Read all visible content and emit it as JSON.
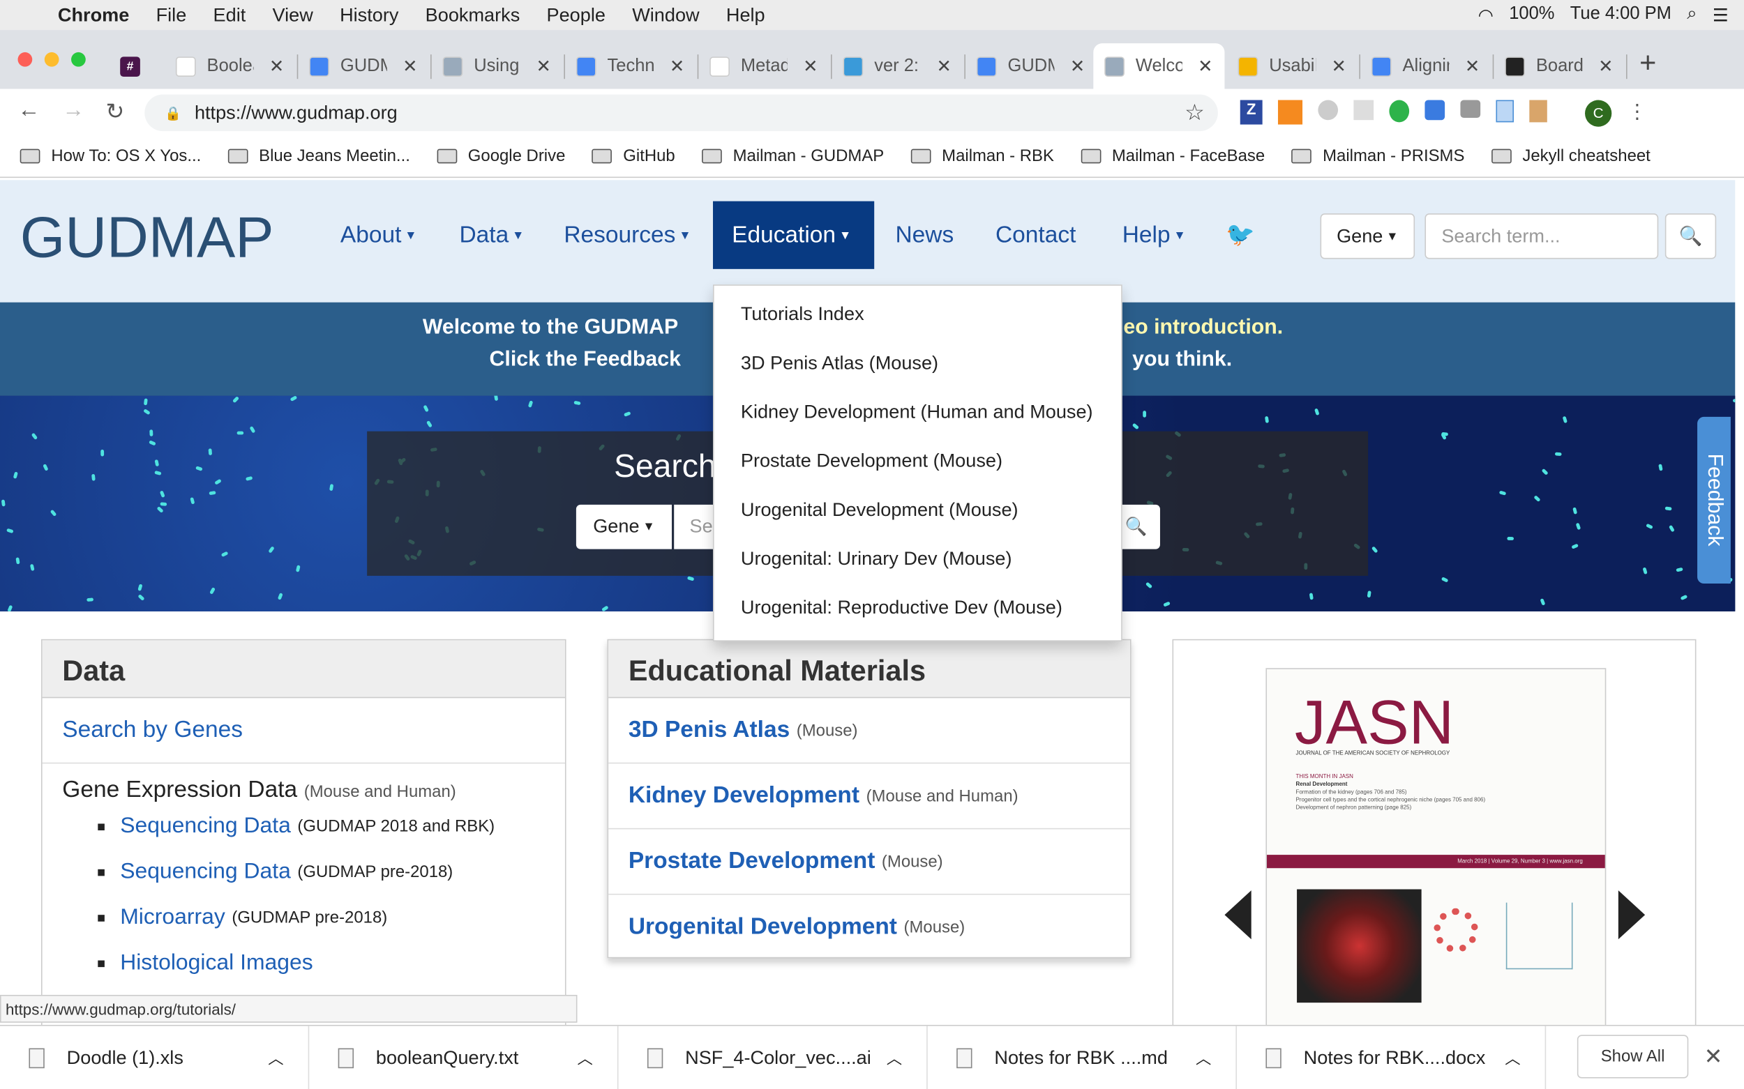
{
  "menubar": {
    "app": "Chrome",
    "items": [
      "File",
      "Edit",
      "View",
      "History",
      "Bookmarks",
      "People",
      "Window",
      "Help"
    ],
    "battery": "100%",
    "clock": "Tue 4:00 PM"
  },
  "tabs": [
    {
      "title": "",
      "icon": "slack-icon",
      "color": "#4a154b"
    },
    {
      "title": "Boolean",
      "icon": "graph-icon",
      "color": "#fff"
    },
    {
      "title": "GUDMAP",
      "icon": "docs-icon",
      "color": "#4285f4"
    },
    {
      "title": "Using",
      "icon": "gudmap-icon",
      "color": "#9ab"
    },
    {
      "title": "Technical",
      "icon": "docs-icon",
      "color": "#4285f4"
    },
    {
      "title": "Metadata",
      "icon": "w3c-icon",
      "color": "#fff"
    },
    {
      "title": "ver 2:",
      "icon": "d-icon",
      "color": "#3a9ad9"
    },
    {
      "title": "GUDMAP",
      "icon": "docs-icon",
      "color": "#4285f4"
    },
    {
      "title": "Welcome",
      "icon": "gudmap-icon",
      "color": "#9ab",
      "active": true
    },
    {
      "title": "Usability",
      "icon": "drive-icon",
      "color": "#f4b400"
    },
    {
      "title": "Aligning",
      "icon": "docs-icon",
      "color": "#4285f4"
    },
    {
      "title": "Board",
      "icon": "github-icon",
      "color": "#222"
    }
  ],
  "url": "https://www.gudmap.org",
  "profile_initial": "C",
  "bookmarks": [
    "How To: OS X Yos...",
    "Blue Jeans Meetin...",
    "Google Drive",
    "GitHub",
    "Mailman - GUDMAP",
    "Mailman - RBK",
    "Mailman - FaceBase",
    "Mailman - PRISMS",
    "Jekyll cheatsheet"
  ],
  "site": {
    "logo": "GUDMAP",
    "nav": [
      "About",
      "Data",
      "Resources",
      "Education",
      "News",
      "Contact",
      "Help"
    ],
    "active_nav": "Education",
    "search_type": "Gene",
    "search_placeholder": "Search term...",
    "banner_line1": "Welcome to the GUDMAP",
    "banner_line1_end": "eo introduction.",
    "banner_line2": "Click the Feedback",
    "banner_line2_end": "you think.",
    "hero_title": "Search",
    "hero_search_type": "Gene",
    "hero_placeholder": "Se",
    "feedback": "Feedback",
    "education_menu": [
      "Tutorials Index",
      "3D Penis Atlas (Mouse)",
      "Kidney Development (Human and Mouse)",
      "Prostate Development (Mouse)",
      "Urogenital Development (Mouse)",
      "Urogenital: Urinary Dev (Mouse)",
      "Urogenital: Reproductive Dev (Mouse)"
    ],
    "data_panel": {
      "title": "Data",
      "search_link": "Search by Genes",
      "gene_expr": "Gene Expression Data",
      "gene_expr_note": "(Mouse and Human)",
      "items": [
        {
          "link": "Sequencing Data",
          "note": "(GUDMAP 2018 and RBK)"
        },
        {
          "link": "Sequencing Data",
          "note": "(GUDMAP pre-2018)"
        },
        {
          "link": "Microarray",
          "note": "(GUDMAP pre-2018)"
        },
        {
          "link": "Histological Images",
          "note": ""
        }
      ]
    },
    "edu_panel": {
      "title": "Educational Materials",
      "items": [
        {
          "link": "3D Penis Atlas",
          "note": "(Mouse)"
        },
        {
          "link": "Kidney Development",
          "note": "(Mouse and Human)"
        },
        {
          "link": "Prostate Development",
          "note": "(Mouse)"
        },
        {
          "link": "Urogenital Development",
          "note": "(Mouse)"
        }
      ]
    },
    "journal": {
      "title": "JASN",
      "subtitle": "JOURNAL OF THE AMERICAN SOCIETY OF NEPHROLOGY",
      "this_month": "THIS MONTH IN JASN",
      "topic": "Renal Development",
      "lines": [
        "Formation of the kidney (pages 706 and 785)",
        "Progenitor cell types and the cortical nephrogenic niche (pages 705 and 806)",
        "Development of nephron patterning (page 825)"
      ],
      "footer": "March 2018 | Volume 29, Number 3 | www.jasn.org"
    }
  },
  "status_url": "https://www.gudmap.org/tutorials/",
  "downloads": [
    "Doodle (1).xls",
    "booleanQuery.txt",
    "NSF_4-Color_vec....ai",
    "Notes for RBK ....md",
    "Notes for RBK....docx"
  ],
  "show_all": "Show All"
}
